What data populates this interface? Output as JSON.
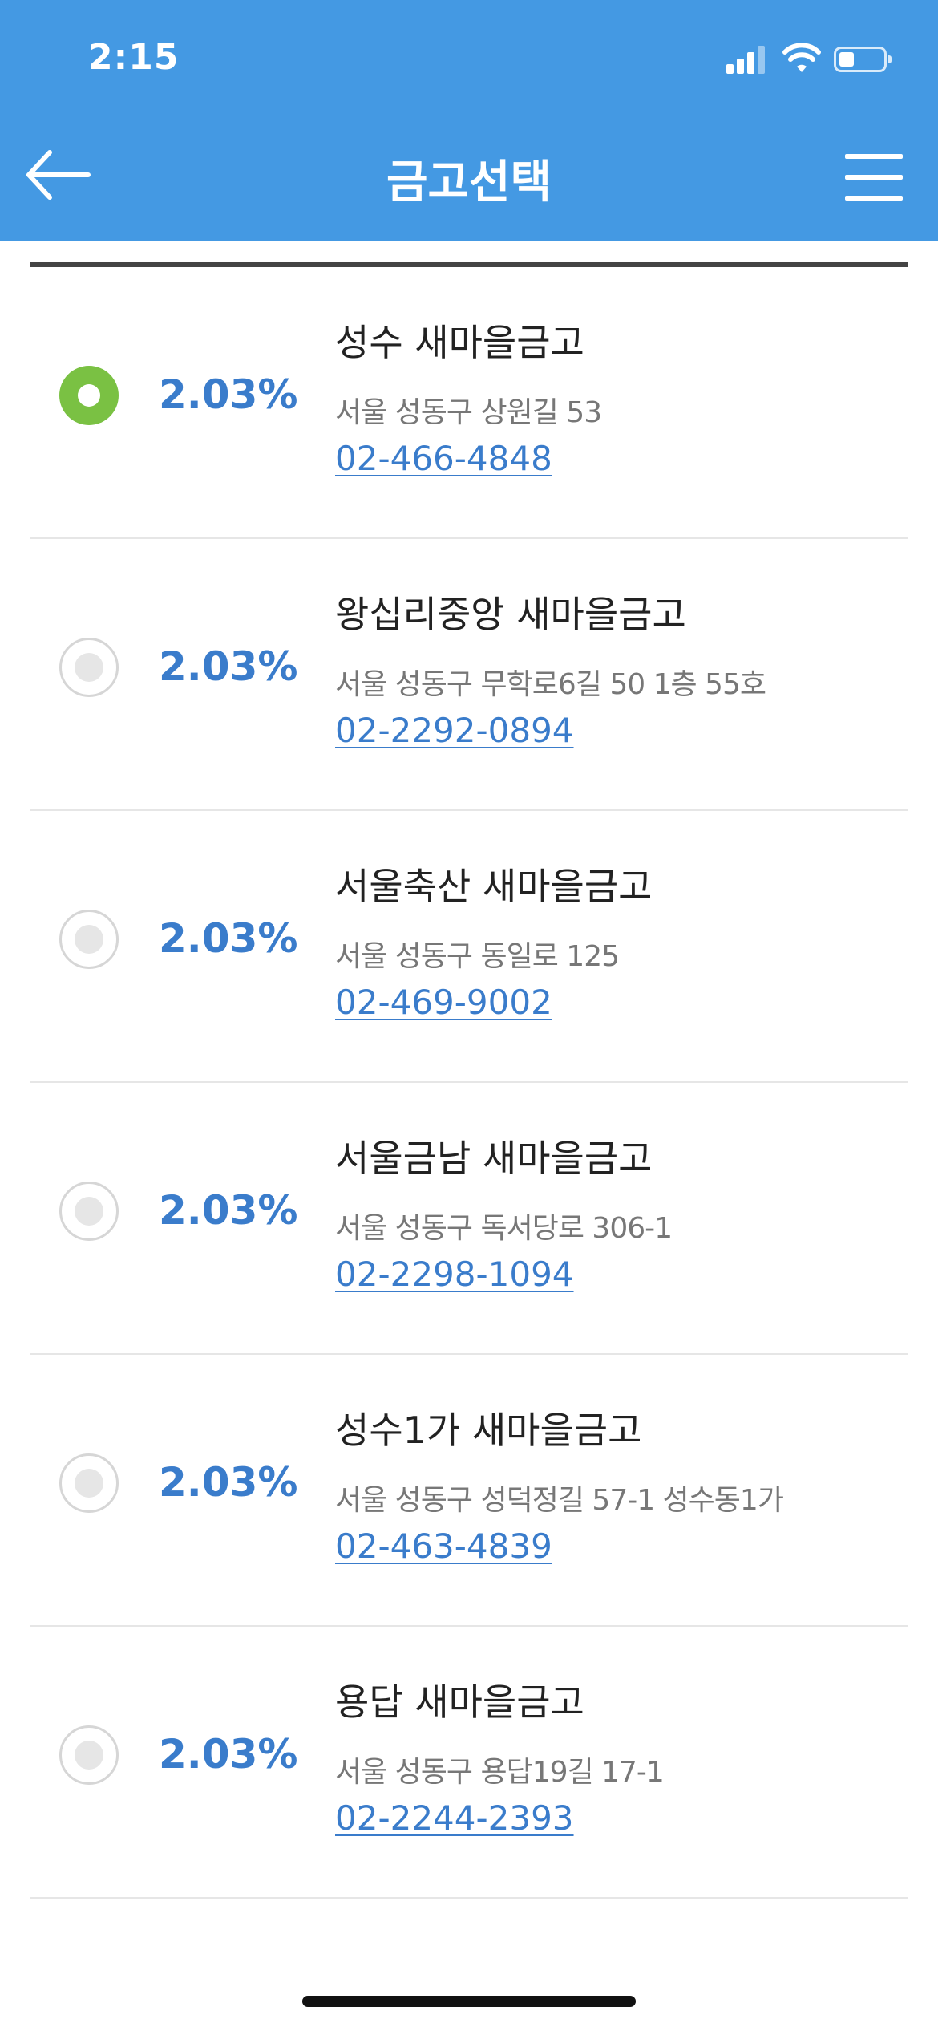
{
  "status_bar": {
    "time": "2:15",
    "signal_icon": "cellular-signal-icon",
    "wifi_icon": "wifi-icon",
    "battery_icon": "battery-icon"
  },
  "header": {
    "title": "금고선택",
    "back_icon": "arrow-left-icon",
    "menu_icon": "hamburger-menu-icon",
    "background_color": "#4499e3"
  },
  "colors": {
    "rate": "#3a7ccb",
    "selected_radio": "#7ac143",
    "phone_link": "#3a7ccb"
  },
  "branches": [
    {
      "selected": true,
      "rate": "2.03%",
      "name": "성수 새마을금고",
      "address": "서울 성동구 상원길 53",
      "phone": "02-466-4848"
    },
    {
      "selected": false,
      "rate": "2.03%",
      "name": "왕십리중앙 새마을금고",
      "address": "서울 성동구 무학로6길 50 1층 55호",
      "phone": "02-2292-0894"
    },
    {
      "selected": false,
      "rate": "2.03%",
      "name": "서울축산 새마을금고",
      "address": "서울 성동구 동일로 125",
      "phone": "02-469-9002"
    },
    {
      "selected": false,
      "rate": "2.03%",
      "name": "서울금남 새마을금고",
      "address": "서울 성동구 독서당로 306-1",
      "phone": "02-2298-1094"
    },
    {
      "selected": false,
      "rate": "2.03%",
      "name": "성수1가 새마을금고",
      "address": "서울 성동구 성덕정길 57-1 성수동1가",
      "phone": "02-463-4839"
    },
    {
      "selected": false,
      "rate": "2.03%",
      "name": "용답 새마을금고",
      "address": "서울 성동구 용답19길 17-1",
      "phone": "02-2244-2393"
    }
  ]
}
